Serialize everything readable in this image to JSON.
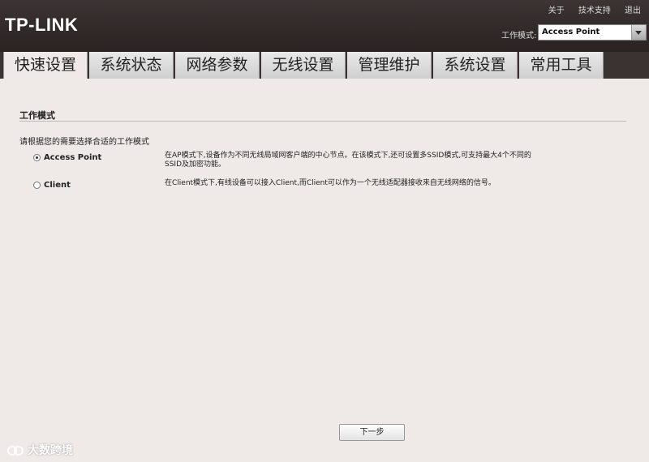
{
  "header": {
    "logo": "TP-LINK",
    "links": [
      "关于",
      "技术支持",
      "退出"
    ],
    "mode_label": "工作模式:",
    "mode_value": "Access Point"
  },
  "tabs": [
    "快速设置",
    "系统状态",
    "网络参数",
    "无线设置",
    "管理维护",
    "系统设置",
    "常用工具"
  ],
  "main": {
    "section_title": "工作模式",
    "prompt": "请根据您的需要选择合适的工作模式",
    "options": [
      {
        "label": "Access Point",
        "checked": true,
        "desc_line1": "在AP模式下,设备作为不同无线局域网客户端的中心节点。在该模式下,还可设置多SSID模式,可支持最大4个不同的",
        "desc_line2": "SSID及加密功能。"
      },
      {
        "label": "Client",
        "checked": false,
        "desc_line1": "在Client模式下,有线设备可以接入Client,而Client可以作为一个无线适配器接收来自无线网络的信号。",
        "desc_line2": ""
      }
    ],
    "next_label": "下一步"
  },
  "watermark": {
    "text": "大数跨境"
  }
}
